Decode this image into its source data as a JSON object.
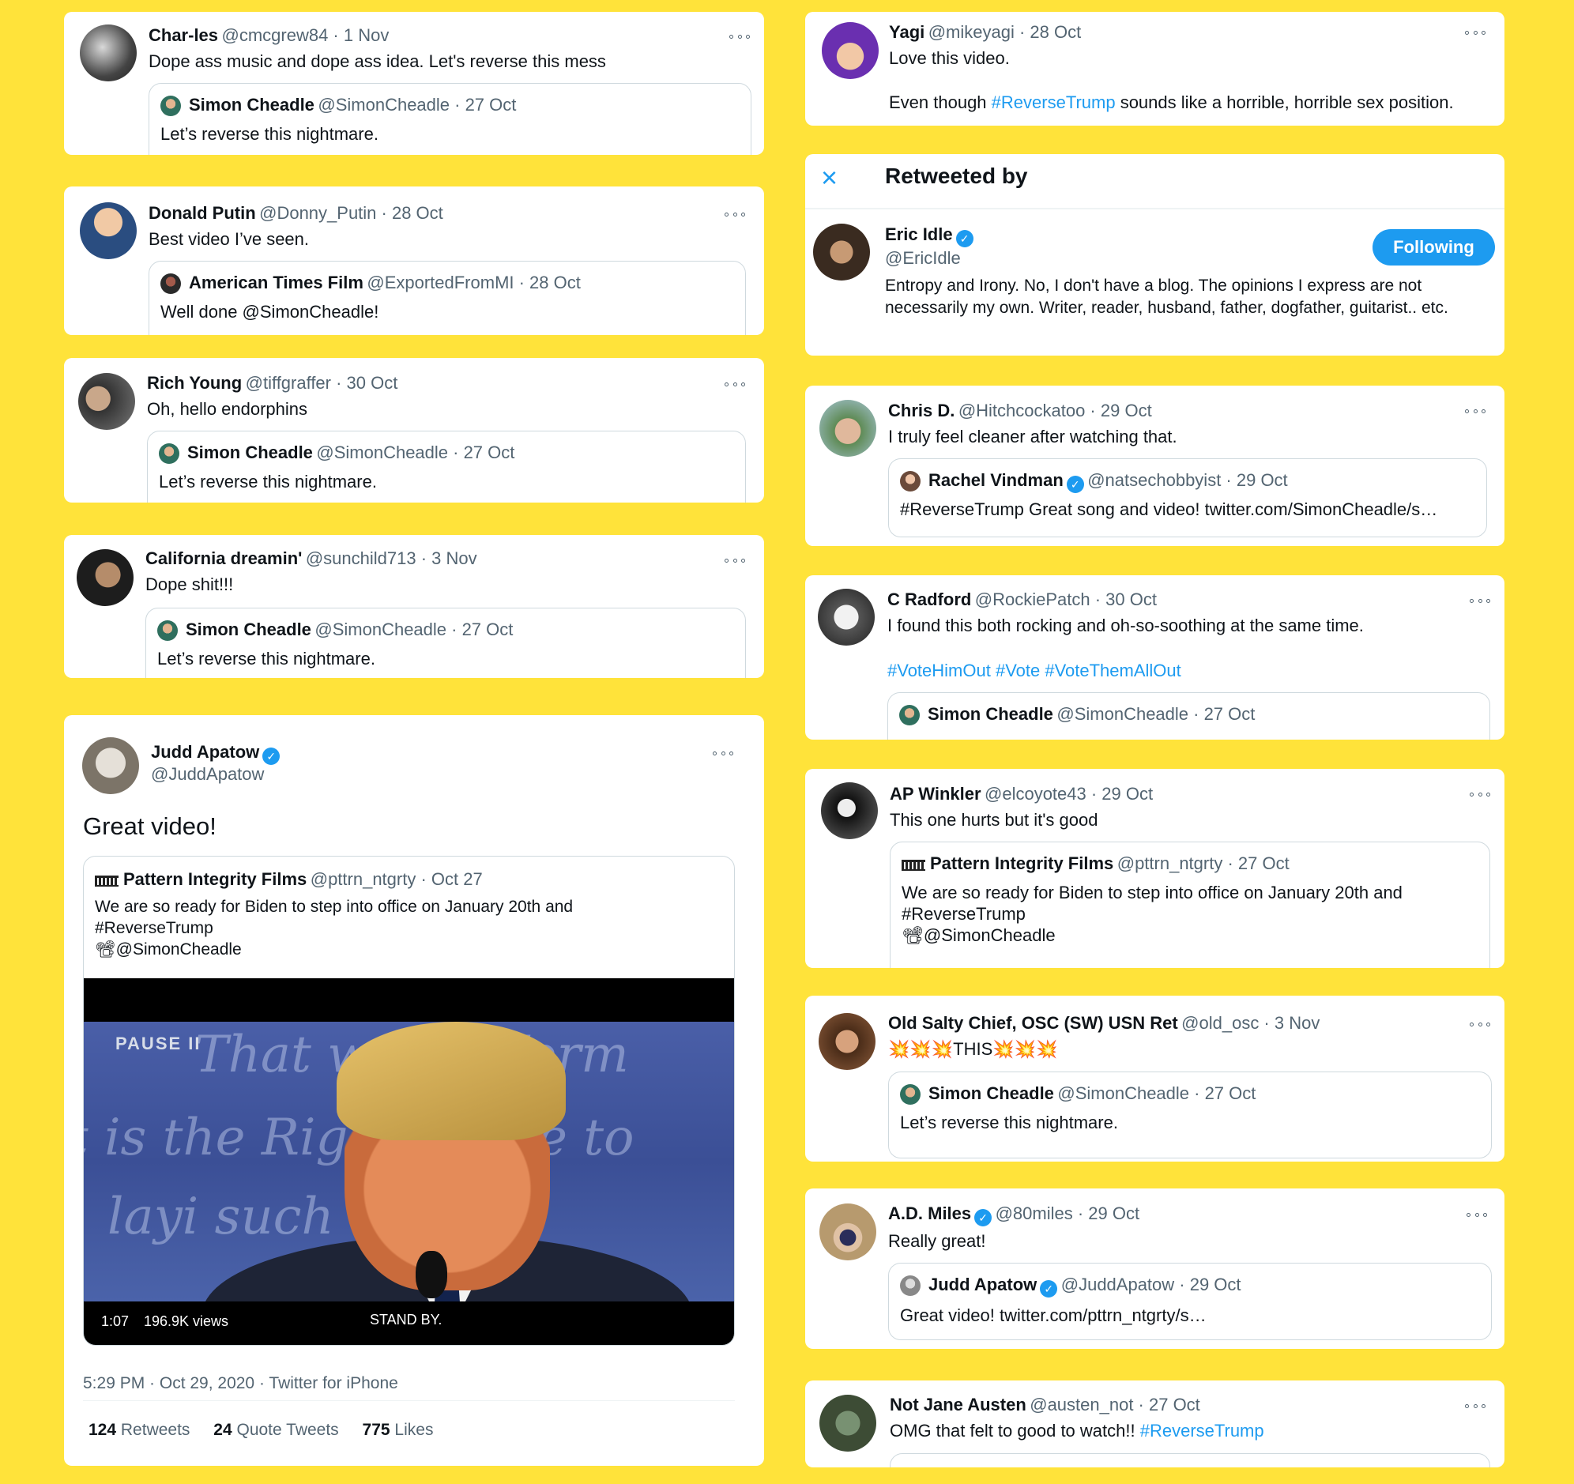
{
  "left": {
    "t1": {
      "name": "Char-les",
      "handle": "@cmcgrew84 · 1 Nov",
      "text": "Dope ass music and dope ass idea. Let's reverse this mess",
      "quote": {
        "name": "Simon Cheadle",
        "handle": "@SimonCheadle · 27 Oct",
        "text": "Let’s reverse this nightmare."
      }
    },
    "t2": {
      "name": "Donald Putin",
      "handle": "@Donny_Putin · 28 Oct",
      "text": "Best video I’ve seen.",
      "quote": {
        "name": "American Times Film",
        "handle": "@ExportedFromMI · 28 Oct",
        "text": "Well done @SimonCheadle!"
      }
    },
    "t3": {
      "name": "Rich Young",
      "handle": "@tiffgraffer · 30 Oct",
      "text": "Oh, hello endorphins",
      "quote": {
        "name": "Simon Cheadle",
        "handle": "@SimonCheadle · 27 Oct",
        "text": "Let’s reverse this nightmare."
      }
    },
    "t4": {
      "name": "California dreamin'",
      "handle": "@sunchild713 · 3 Nov",
      "text": "Dope shit!!!",
      "quote": {
        "name": "Simon Cheadle",
        "handle": "@SimonCheadle · 27 Oct",
        "text": "Let’s reverse this nightmare."
      }
    },
    "main": {
      "name": "Judd Apatow",
      "handle": "@JuddApatow",
      "text": "Great video!",
      "quote": {
        "name": "Pattern Integrity Films",
        "handle": "@pttrn_ntgrty · Oct 27",
        "line1": "We are so ready for Biden to step into office on January 20th and",
        "line2": "#ReverseTrump",
        "line3": "📽@SimonCheadle"
      },
      "video": {
        "pause": "PAUSE II",
        "time": "1:07",
        "views": "196.9K views",
        "standby": "STAND BY.",
        "script1": "That w    any Form",
        "script2": "t is the Righ    People to",
        "script3": "layi         such"
      },
      "timestamp": "5:29 PM · Oct 29, 2020 · Twitter for iPhone",
      "stats": {
        "retweets_n": "124",
        "retweets_l": "Retweets",
        "quotes_n": "24",
        "quotes_l": "Quote Tweets",
        "likes_n": "775",
        "likes_l": "Likes"
      }
    }
  },
  "right": {
    "yagi": {
      "name": "Yagi",
      "handle": "@mikeyagi · 28 Oct",
      "line1": "Love this video.",
      "pre": "Even though ",
      "tag": "#ReverseTrump",
      "post": " sounds like a horrible, horrible sex position."
    },
    "retweeted": {
      "title": "Retweeted by",
      "name": "Eric Idle",
      "handle": "@EricIdle",
      "button": "Following",
      "bio": "Entropy and Irony. No, I don't have a blog. The opinions I express are not necessarily my own. Writer, reader, husband, father, dogfather, guitarist.. etc."
    },
    "chris": {
      "name": "Chris D.",
      "handle": "@Hitchcockatoo · 29 Oct",
      "text": "I truly feel cleaner after watching that.",
      "quote": {
        "name": "Rachel Vindman",
        "handle": "@natsechobbyist · 29 Oct",
        "text": "#ReverseTrump Great song and video! twitter.com/SimonCheadle/s…"
      }
    },
    "radford": {
      "name": "C Radford",
      "handle": "@RockiePatch · 30 Oct",
      "text": "I found this both rocking and oh-so-soothing at the same time.",
      "tags": "#VoteHimOut #Vote #VoteThemAllOut",
      "quote": {
        "name": "Simon Cheadle",
        "handle": "@SimonCheadle · 27 Oct"
      }
    },
    "winkler": {
      "name": "AP Winkler",
      "handle": "@elcoyote43 · 29 Oct",
      "text": "This one hurts but it's good",
      "quote": {
        "name": "Pattern Integrity Films",
        "handle": "@pttrn_ntgrty · 27 Oct",
        "line1": "We are so ready for Biden to step into office on January 20th and",
        "line2": "#ReverseTrump",
        "line3": "📽@SimonCheadle"
      }
    },
    "chief": {
      "name": "Old Salty Chief, OSC (SW) USN Ret",
      "handle": "@old_osc · 3 Nov",
      "text": "💥💥💥THIS💥💥💥",
      "quote": {
        "name": "Simon Cheadle",
        "handle": "@SimonCheadle · 27 Oct",
        "text": "Let’s reverse this nightmare."
      }
    },
    "miles": {
      "name": "A.D. Miles",
      "handle": "@80miles · 29 Oct",
      "text": "Really great!",
      "quote": {
        "name": "Judd Apatow",
        "handle": "@JuddApatow · 29 Oct",
        "text": "Great video! twitter.com/pttrn_ntgrty/s…"
      }
    },
    "austen": {
      "name": "Not Jane Austen",
      "handle": "@austen_not · 27 Oct",
      "text": "OMG that felt to good to watch!! ",
      "tag": "#ReverseTrump"
    }
  },
  "colors": {
    "background": "#FFE33A",
    "accent": "#1d9bf0",
    "text": "#0f1419",
    "secondary": "#536471"
  },
  "icons": {
    "menu": "more-dots-icon",
    "verified": "verified-badge-icon",
    "close": "close-icon"
  }
}
